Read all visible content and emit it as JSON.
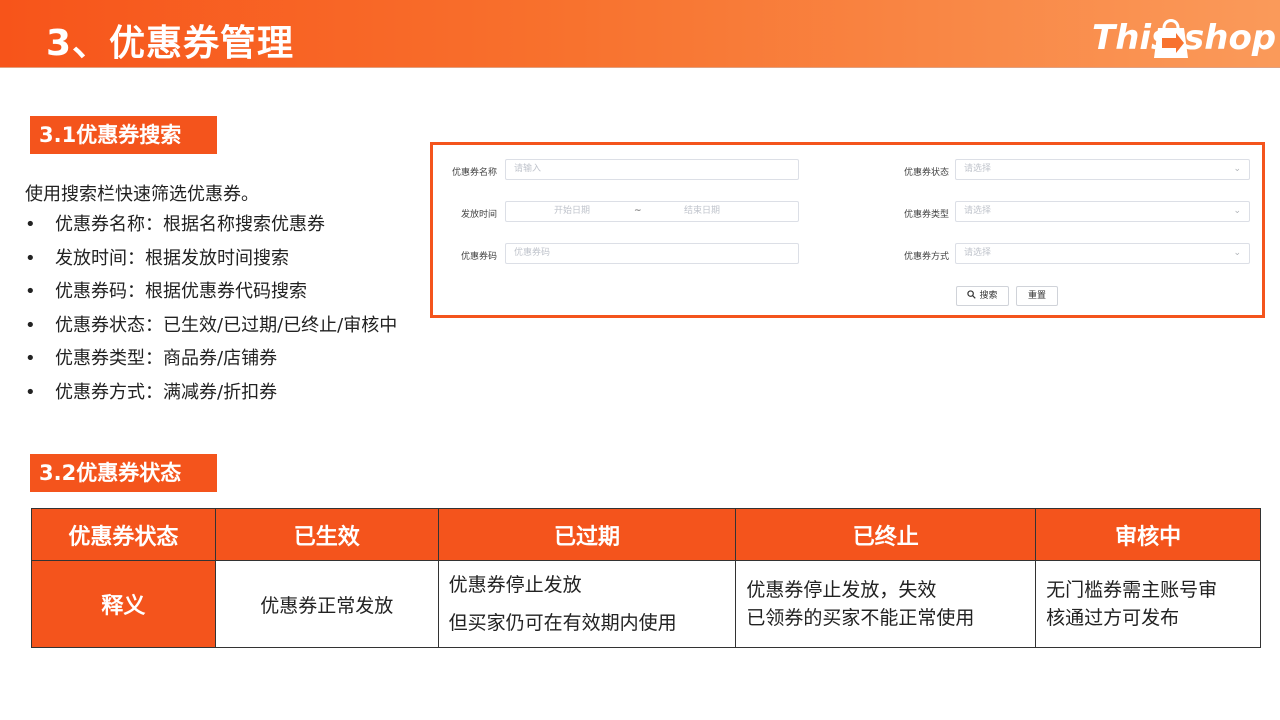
{
  "header": {
    "title": "3、优惠券管理",
    "logo_left": "This",
    "logo_right": "shop"
  },
  "section1": {
    "tag": "3.1优惠券搜索",
    "intro": "使用搜索栏快速筛选优惠券。",
    "bullets": [
      "优惠券名称：根据名称搜索优惠券",
      "发放时间：根据发放时间搜索",
      "优惠券码：根据优惠券代码搜索",
      "优惠券状态：已生效/已过期/已终止/审核中",
      "优惠券类型：商品券/店铺券",
      "优惠券方式：满减券/折扣券"
    ],
    "bullet_symbol": "•"
  },
  "form": {
    "name_label": "优惠券名称",
    "name_placeholder": "请输入",
    "time_label": "发放时间",
    "start_placeholder": "开始日期",
    "tilde": "~",
    "end_placeholder": "结束日期",
    "code_label": "优惠券码",
    "code_placeholder": "优惠券码",
    "status_label": "优惠券状态",
    "status_placeholder": "请选择",
    "type_label": "优惠券类型",
    "type_placeholder": "请选择",
    "method_label": "优惠券方式",
    "method_placeholder": "请选择",
    "search_button": "搜索",
    "reset_button": "重置"
  },
  "section2": {
    "tag": "3.2优惠券状态"
  },
  "status_table": {
    "headers": [
      "优惠券状态",
      "已生效",
      "已过期",
      "已终止",
      "审核中"
    ],
    "row_label": "释义",
    "cells": [
      [
        "优惠券正常发放"
      ],
      [
        "优惠券停止发放",
        "但买家仍可在有效期内使用"
      ],
      [
        "优惠券停止发放，失效",
        "已领券的买家不能正常使用"
      ],
      [
        "无门槛券需主账号审",
        "核通过方可发布"
      ]
    ]
  },
  "colors": {
    "accent": "#f4541c",
    "header_gradient_start": "#f7541a",
    "header_gradient_end": "#fa9a5a"
  }
}
